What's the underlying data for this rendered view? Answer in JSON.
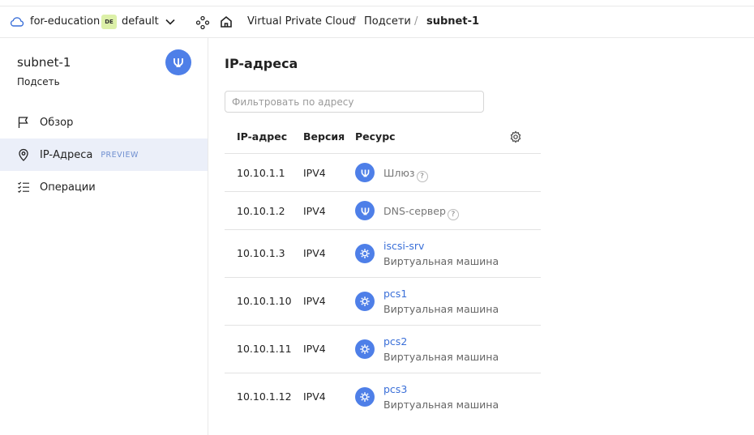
{
  "header": {
    "org": "for-education",
    "folder_badge": "DE",
    "folder": "default",
    "breadcrumbs": [
      "Virtual Private Cloud",
      "Подсети",
      "subnet-1"
    ]
  },
  "sidebar": {
    "title": "subnet-1",
    "subtitle": "Подсеть",
    "items": [
      {
        "label": "Обзор",
        "icon": "flag-icon"
      },
      {
        "label": "IP-Адреса",
        "icon": "location-pin-icon",
        "tag": "PREVIEW",
        "active": true
      },
      {
        "label": "Операции",
        "icon": "list-check-icon"
      }
    ]
  },
  "main": {
    "title": "IP-адреса",
    "filter_placeholder": "Фильтровать по адресу",
    "columns": [
      "IP-адрес",
      "Версия",
      "Ресурс"
    ],
    "rows": [
      {
        "ip": "10.10.1.1",
        "version": "IPV4",
        "resource": "Шлюз",
        "resource_type": "",
        "icon": "gateway-icon",
        "help": "?"
      },
      {
        "ip": "10.10.1.2",
        "version": "IPV4",
        "resource": "DNS-сервер",
        "resource_type": "",
        "icon": "gateway-icon",
        "help": "?"
      },
      {
        "ip": "10.10.1.3",
        "version": "IPV4",
        "resource": "iscsi-srv",
        "resource_type": "Виртуальная машина",
        "icon": "vm-icon"
      },
      {
        "ip": "10.10.1.10",
        "version": "IPV4",
        "resource": "pcs1",
        "resource_type": "Виртуальная машина",
        "icon": "vm-icon"
      },
      {
        "ip": "10.10.1.11",
        "version": "IPV4",
        "resource": "pcs2",
        "resource_type": "Виртуальная машина",
        "icon": "vm-icon"
      },
      {
        "ip": "10.10.1.12",
        "version": "IPV4",
        "resource": "pcs3",
        "resource_type": "Виртуальная машина",
        "icon": "vm-icon"
      }
    ]
  },
  "colors": {
    "accent": "#4e7fe8",
    "link": "#3a6fd8",
    "active_bg": "#ebeff9",
    "badge_bg": "#dcf0a8"
  }
}
